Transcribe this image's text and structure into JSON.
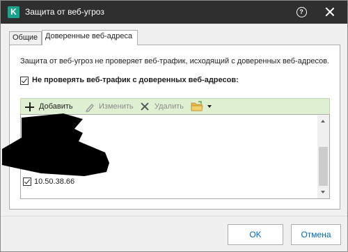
{
  "window": {
    "title": "Защита от веб-угроз",
    "app_logo_letter": "K",
    "help_symbol": "?"
  },
  "tabs": [
    {
      "label": "Общие",
      "selected": false
    },
    {
      "label": "Доверенные веб-адреса",
      "selected": true
    }
  ],
  "panel": {
    "description": "Защита от веб-угроз не проверяет веб-трафик, исходящий с доверенных веб-адресов.",
    "skip_checkbox": {
      "label": "Не проверять веб-трафик с доверенных веб-адресов:",
      "checked": true
    }
  },
  "toolbar": {
    "add_label": "Добавить",
    "edit_label": "Изменить",
    "delete_label": "Удалить",
    "add_enabled": true,
    "edit_enabled": false,
    "delete_enabled": false,
    "folder_icon": "folder-import-icon"
  },
  "list": {
    "items": [
      {
        "address": "10.50.38.66",
        "checked": true
      }
    ]
  },
  "footer": {
    "ok_label": "OK",
    "cancel_label": "Отмена"
  },
  "colors": {
    "titlebar_bg": "#2f2f2f",
    "brand": "#1aa38c",
    "toolbar_bg": "#dff0d2",
    "button_text": "#0067b8",
    "disabled_text": "#8c8c8c"
  }
}
